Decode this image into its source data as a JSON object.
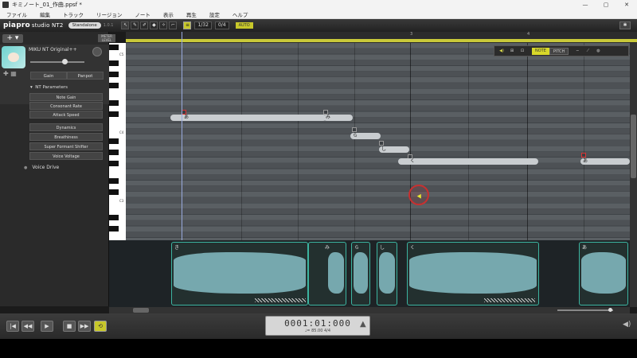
{
  "window": {
    "title": "キミノート_01_作曲.ppsf *",
    "minimize": "—",
    "maximize": "▢",
    "close": "✕"
  },
  "menu": [
    "ファイル",
    "編集",
    "トラック",
    "リージョン",
    "ノート",
    "表示",
    "再生",
    "設定",
    "ヘルプ"
  ],
  "toolbar": {
    "logo": "piapro",
    "logo_sub": "studio NT2",
    "mode": "Standalone",
    "version": "1.0.1",
    "tools": [
      "↖",
      "✎",
      "✐",
      "◆",
      "✧",
      "⌐"
    ],
    "snap_label": "1/32",
    "quant_label": "0/4",
    "auto_label": "AUTO",
    "settings_icon": "✱"
  },
  "track": {
    "add_label": "+ ▾",
    "name": "MIKU NT Original++",
    "gain_label": "Gain",
    "panpot_label": "Panpot",
    "nt_params_label": "NT Parameters",
    "params": [
      "Note Gain",
      "Consonant Rate",
      "Attack Speed"
    ],
    "params2": [
      "Dynamics",
      "Breathiness",
      "Super Formant Shifter",
      "Voice Voltage"
    ],
    "voice_drive_label": "Voice Drive",
    "meter_label": "METER LEVEL"
  },
  "keys": [
    "C5",
    "C4",
    "C3"
  ],
  "ruler": [
    "3",
    "4"
  ],
  "notes": [
    {
      "lyric": "あ"
    },
    {
      "lyric": "み"
    },
    {
      "lyric": "ら"
    },
    {
      "lyric": "し"
    },
    {
      "lyric": "く"
    },
    {
      "lyric": "あ"
    }
  ],
  "view": {
    "note_label": "NOTE",
    "pitch_label": "PITCH"
  },
  "waveform": {
    "labels": [
      "き",
      "み",
      "ら",
      "し",
      "く",
      "あ"
    ]
  },
  "transport": {
    "buttons": [
      "|◀",
      "◀◀",
      "▶",
      "■",
      "▶▶",
      "⟲"
    ],
    "time": "0001:01:000",
    "tempo": "♩= 85.00  4/4"
  },
  "colors": {
    "accent": "#c8c82a",
    "note": "#c9cdd0",
    "wave": "#7fb6bd",
    "wave_border": "#3cb4a0"
  }
}
